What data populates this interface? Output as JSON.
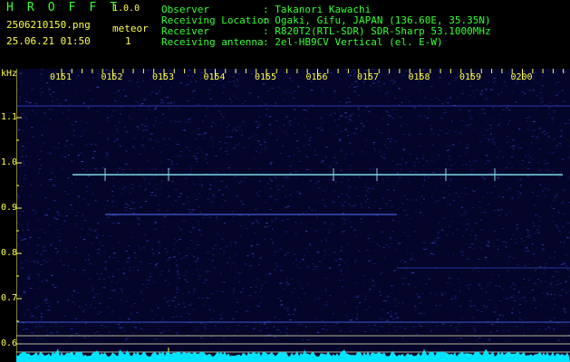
{
  "app": {
    "name": "H R O F F T",
    "version": "1.0.0"
  },
  "capture": {
    "filename": "2506210150.png",
    "datetime": "25.06.21 01:50"
  },
  "detection": {
    "label": "meteor",
    "count": "1"
  },
  "info": [
    {
      "key": "Observer",
      "value": ": Takanori Kawachi"
    },
    {
      "key": "Receiving Location",
      "value": ": Ogaki, Gifu, JAPAN (136.60E, 35.35N)"
    },
    {
      "key": "Receiver",
      "value": ": R820T2(RTL-SDR) SDR-Sharp 53.1000MHz"
    },
    {
      "key": "Receiving antenna",
      "value": ": 2el-HB9CV Vertical (el. E-W)"
    }
  ],
  "spectrogram": {
    "y_unit": "kHz",
    "y_ticks": [
      "1.1",
      "1.0",
      "0.9",
      "0.8",
      "0.7",
      "0.6"
    ],
    "x_ticks": [
      "0151",
      "0152",
      "0153",
      "0154",
      "0155",
      "0156",
      "0157",
      "0158",
      "0159",
      "0200"
    ],
    "colors": {
      "background": "#05052a",
      "noise": "#2a3cb4",
      "carrier": "#7fd8e8",
      "axis": "#ffff44",
      "trace": "#00e5ff"
    }
  }
}
